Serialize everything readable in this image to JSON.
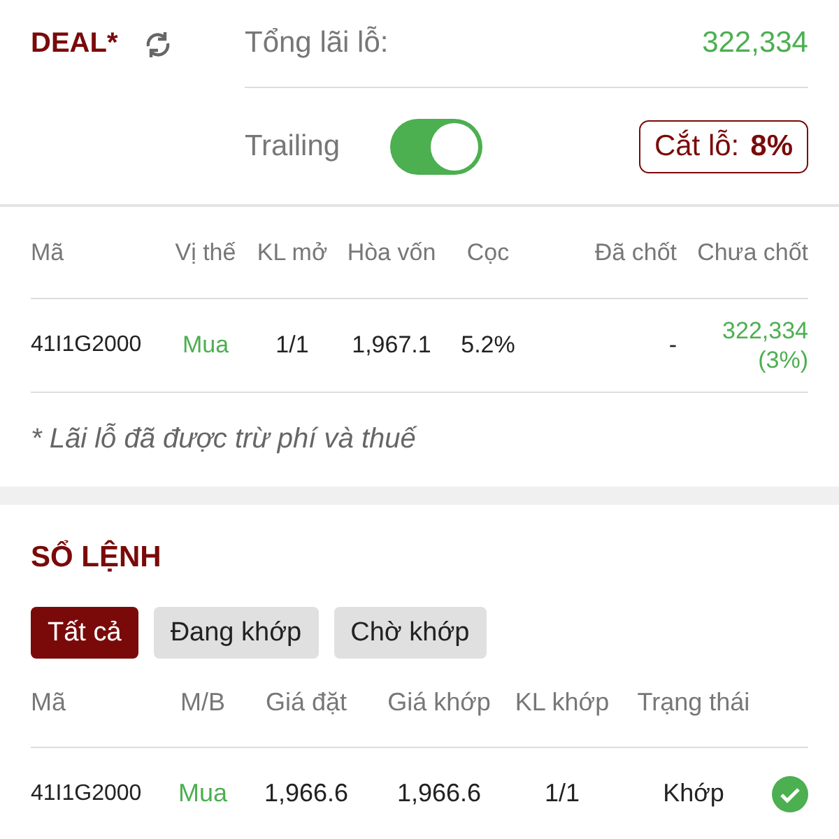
{
  "deal": {
    "title": "DEAL*",
    "total_label": "Tổng lãi lỗ:",
    "total_value": "322,334",
    "trailing": {
      "label": "Trailing",
      "on": true
    },
    "stop_loss": {
      "label": "Cắt lỗ:",
      "value": "8%"
    }
  },
  "positions": {
    "columns": [
      "Mã",
      "Vị thế",
      "KL mở",
      "Hòa vốn",
      "Cọc",
      "Đã chốt",
      "Chưa chốt"
    ],
    "rows": [
      {
        "code": "41I1G2000",
        "side": "Mua",
        "open_qty": "1/1",
        "break_even": "1,967.1",
        "deposit": "5.2%",
        "realized": "-",
        "unrealized": "322,334",
        "unrealized_pct": "(3%)"
      }
    ]
  },
  "note": "* Lãi lỗ đã được trừ phí và thuế",
  "order_book": {
    "title": "SỔ LỆNH",
    "filters": [
      {
        "label": "Tất cả",
        "selected": true
      },
      {
        "label": "Đang khớp",
        "selected": false
      },
      {
        "label": "Chờ khớp",
        "selected": false
      }
    ],
    "columns": [
      "Mã",
      "M/B",
      "Giá đặt",
      "Giá khớp",
      "KL khớp",
      "Trạng thái"
    ],
    "rows": [
      {
        "code": "41I1G2000",
        "side": "Mua",
        "order_price": "1,966.6",
        "match_price": "1,966.6",
        "matched_qty": "1/1",
        "status": "Khớp",
        "matched": true
      }
    ]
  }
}
